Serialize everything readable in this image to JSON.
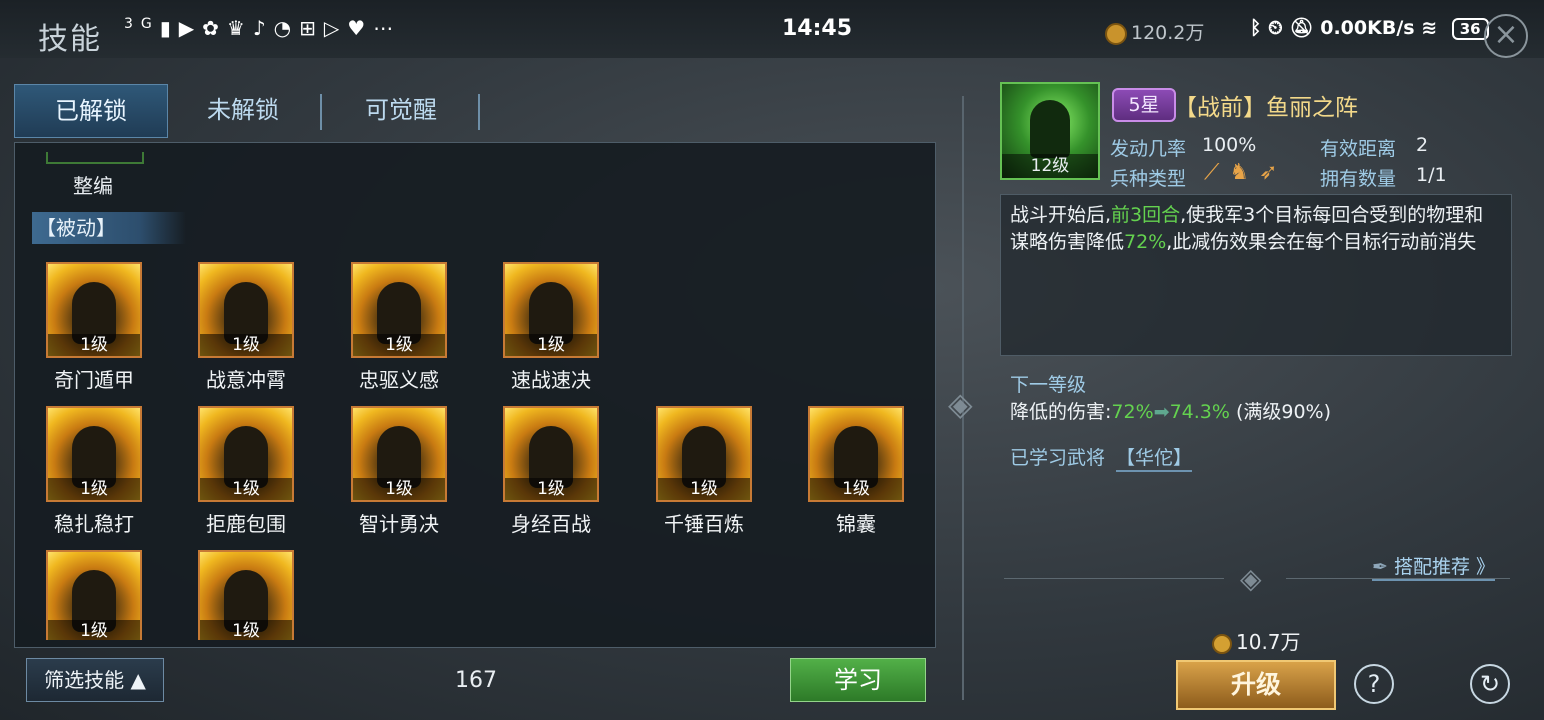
{
  "status_bar": {
    "title": "技能",
    "network": "3G",
    "clock": "14:45",
    "coins": "120.2万",
    "net_speed": "0.00KB/s",
    "battery": "36"
  },
  "tabs": [
    {
      "label": "已解锁",
      "active": true
    },
    {
      "label": "未解锁",
      "active": false
    },
    {
      "label": "可觉醒",
      "active": false
    }
  ],
  "list": {
    "partial_item": "整编",
    "section_header": "【被动】",
    "skills": [
      {
        "level": "1级",
        "name": "奇门遁甲"
      },
      {
        "level": "1级",
        "name": "战意冲霄"
      },
      {
        "level": "1级",
        "name": "忠驱义感"
      },
      {
        "level": "1级",
        "name": "速战速决"
      },
      {
        "level": "1级",
        "name": "稳扎稳打"
      },
      {
        "level": "1级",
        "name": "拒鹿包围"
      },
      {
        "level": "1级",
        "name": "智计勇决"
      },
      {
        "level": "1级",
        "name": "身经百战"
      },
      {
        "level": "1级",
        "name": "千锤百炼"
      },
      {
        "level": "1级",
        "name": "锦囊"
      },
      {
        "level": "1级",
        "name": ""
      },
      {
        "level": "1级",
        "name": ""
      }
    ],
    "filter_label": "筛选技能",
    "count": "167",
    "learn_label": "学习"
  },
  "detail": {
    "portrait_level": "12级",
    "star": "5星",
    "title": "【战前】鱼丽之阵",
    "trigger_label": "发动几率",
    "trigger_value": "100%",
    "range_label": "有效距离",
    "range_value": "2",
    "troop_label": "兵种类型",
    "owned_label": "拥有数量",
    "owned_value": "1/1",
    "desc_1": "战斗开始后,",
    "desc_green_1": "前3回合",
    "desc_2": ",使我军3个目标每回合受到的物理和谋略伤害降低",
    "desc_green_2": "72%",
    "desc_3": ",此减伤效果会在每个目标行动前消失",
    "next_level_label": "下一等级",
    "next_level_prefix": "降低的伤害:",
    "next_from": "72%",
    "next_to": "74.3%",
    "next_max": "(满级90%)",
    "learned_label": "已学习武将",
    "learned_name": "【华佗】",
    "recommend_label": "搭配推荐 》",
    "cost": "10.7万",
    "upgrade_label": "升级"
  }
}
